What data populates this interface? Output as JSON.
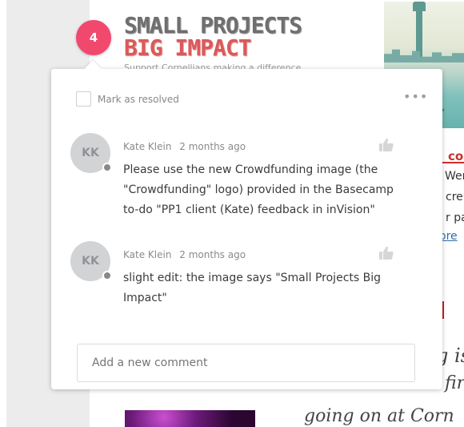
{
  "background": {
    "headline_line1": "SMALL PROJECTS",
    "headline_line2": "BIG IMPACT",
    "headline_sub": "Support Cornellians making a difference",
    "fragment_title": "co",
    "fragment_1": "Wen",
    "fragment_2": "cre",
    "fragment_3": "r pa",
    "fragment_link": "ore",
    "serif_1": "g is",
    "serif_2": "fir",
    "serif_3": "going on at Corn"
  },
  "badge": {
    "count": "4"
  },
  "popover": {
    "resolve_label": "Mark as resolved",
    "more_icon": "more-dots-icon",
    "new_comment_placeholder": "Add a new comment"
  },
  "comments": [
    {
      "initials": "KK",
      "author": "Kate Klein",
      "time": "2 months ago",
      "text": "Please use the new Crowdfunding image (the \"Crowdfunding\" logo) provided in the Basecamp to-do \"PP1 client (Kate) feedback in inVision\""
    },
    {
      "initials": "KK",
      "author": "Kate Klein",
      "time": "2 months ago",
      "text": "slight edit: the image says \"Small Projects Big Impact\""
    }
  ],
  "colors": {
    "badge": "#f0496d",
    "avatar": "#d2d3d5",
    "accent_red": "#c8302e"
  }
}
